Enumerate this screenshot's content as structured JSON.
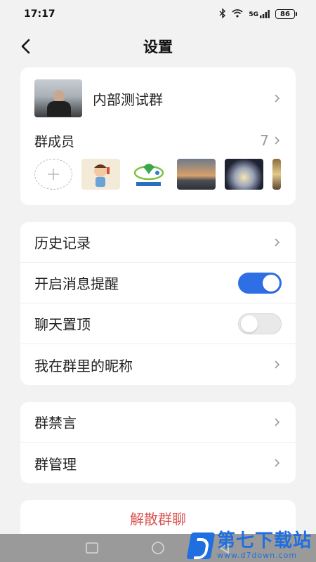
{
  "status_bar": {
    "time": "17:17",
    "icons": [
      "bluetooth-icon",
      "wifi-icon",
      "signal-icon"
    ],
    "network": "5G",
    "battery": "86"
  },
  "header": {
    "back_icon": "chevron-left-icon",
    "title": "设置"
  },
  "group": {
    "name": "内部测试群",
    "members_label": "群成员",
    "members_count": "7",
    "add_icon": "plus-icon"
  },
  "settings": {
    "history": "历史记录",
    "message_alert": "开启消息提醒",
    "message_alert_on": true,
    "pin_chat": "聊天置顶",
    "pin_chat_on": false,
    "my_nickname": "我在群里的昵称"
  },
  "admin": {
    "mute": "群禁言",
    "manage": "群管理"
  },
  "dissolve_label": "解散群聊",
  "watermark": {
    "title": "第七下载站",
    "url": "www.d7down.com"
  },
  "colors": {
    "accent": "#2f6fe6",
    "danger": "#d9534f",
    "background": "#f2f2f2"
  }
}
